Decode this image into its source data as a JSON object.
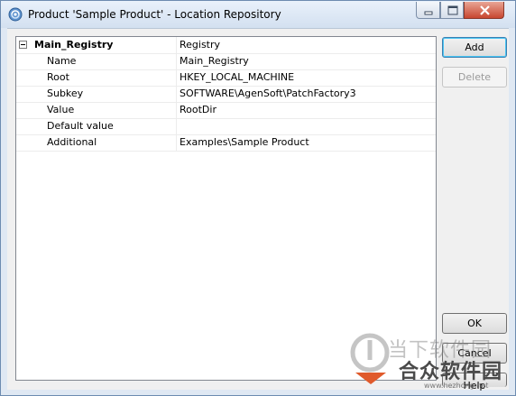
{
  "window": {
    "title": "Product 'Sample Product' - Location Repository",
    "controls": {
      "minimize": "minimize",
      "maximize": "maximize",
      "close": "close"
    }
  },
  "grid": {
    "category": {
      "name": "Main_Registry",
      "value": "Registry"
    },
    "properties": [
      {
        "name": "Name",
        "value": "Main_Registry"
      },
      {
        "name": "Root",
        "value": "HKEY_LOCAL_MACHINE"
      },
      {
        "name": "Subkey",
        "value": "SOFTWARE\\AgenSoft\\PatchFactory3"
      },
      {
        "name": "Value",
        "value": "RootDir"
      },
      {
        "name": "Default value",
        "value": ""
      },
      {
        "name": "Additional",
        "value": "Examples\\Sample Product"
      }
    ]
  },
  "buttons": {
    "add": "Add",
    "delete": "Delete",
    "ok": "OK",
    "cancel": "Cancel",
    "help": "Help"
  },
  "watermark": {
    "line1": "当下软件园",
    "line2": "合众软件园",
    "url": "www.hezhong.net"
  }
}
